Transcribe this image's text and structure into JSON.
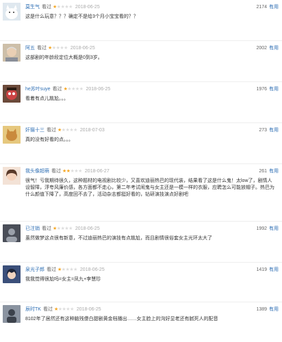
{
  "reviews": [
    {
      "user": "莫生气",
      "action": "看过",
      "stars": 1,
      "date": "2018-06-25",
      "votes": "2174",
      "useful_label": "有用",
      "text": "这是什么玩意？？？确定不是给3个月小宝宝看的？？",
      "avatar_color": "#e8eef2",
      "avatar_icon": "white-cat-avatar"
    },
    {
      "user": "阿五",
      "action": "看过",
      "stars": 1,
      "date": "2018-06-25",
      "votes": "2002",
      "useful_label": "有用",
      "text": "这部剧的年龄段定位大概是0到3岁。",
      "avatar_color": "#c9b9a3",
      "avatar_icon": "man-avatar"
    },
    {
      "user": "he苏叶suye",
      "action": "看过",
      "stars": 1,
      "date": "2018-06-25",
      "votes": "1976",
      "useful_label": "有用",
      "text": "看着有点儿尴尬。。。",
      "avatar_color": "#6b4a3a",
      "avatar_icon": "cartoon-avatar"
    },
    {
      "user": "奸猫十三",
      "action": "看过",
      "stars": 1,
      "date": "2018-07-03",
      "votes": "273",
      "useful_label": "有用",
      "text": "真的没有好看的点。。。",
      "avatar_color": "#d8b86a",
      "avatar_icon": "cat-avatar"
    },
    {
      "user": "我头像超萌",
      "action": "看过",
      "stars": 2,
      "date": "2018-06-27",
      "votes": "261",
      "useful_label": "有用",
      "text": "很气！亏我期待很久，这种题材的电视剧比较少，又喜欢迪丽热巴的现代装，结果看了这是什么鬼！太low了，剧情人设智障，浮夸风廉价感，各方面都不走心，第二年考试闹鬼与女主还是一模一样的衣服，应聘怎么可能放帽子。热巴为什么颜值下降了，高度回不去了，活动杂志都挺好看的，钻研演技演点好剧吧",
      "avatar_color": "#f1d9c9",
      "avatar_icon": "girl-avatar"
    },
    {
      "user": "已注销",
      "action": "看过",
      "stars": 1,
      "date": "2018-06-25",
      "votes": "1992",
      "useful_label": "有用",
      "text": "虽然做梦这点很有新意，不过迪丽热巴的演技有点尴尬，而且剧情很俗套女主光环太大了",
      "avatar_color": "#4a4e58",
      "avatar_icon": "deactivated-avatar"
    },
    {
      "user": "泉光子郎",
      "action": "看过",
      "stars": 1,
      "date": "2018-06-25",
      "votes": "1419",
      "useful_label": "有用",
      "text": "我我觉得很尬吗=女主=凤九+李慧珍",
      "avatar_color": "#3b4f7a",
      "avatar_icon": "anime-avatar"
    },
    {
      "user": "辰时TK",
      "action": "看过",
      "stars": 1,
      "date": "2018-06-25",
      "votes": "1389",
      "useful_label": "有用",
      "text": "8102年了居然还有这种脑残傻白甜剧黄金档播出……女主脸上的沟好显老还有腻死人的配音",
      "avatar_color": "#5a6270",
      "avatar_icon": "silhouette-avatar"
    }
  ]
}
